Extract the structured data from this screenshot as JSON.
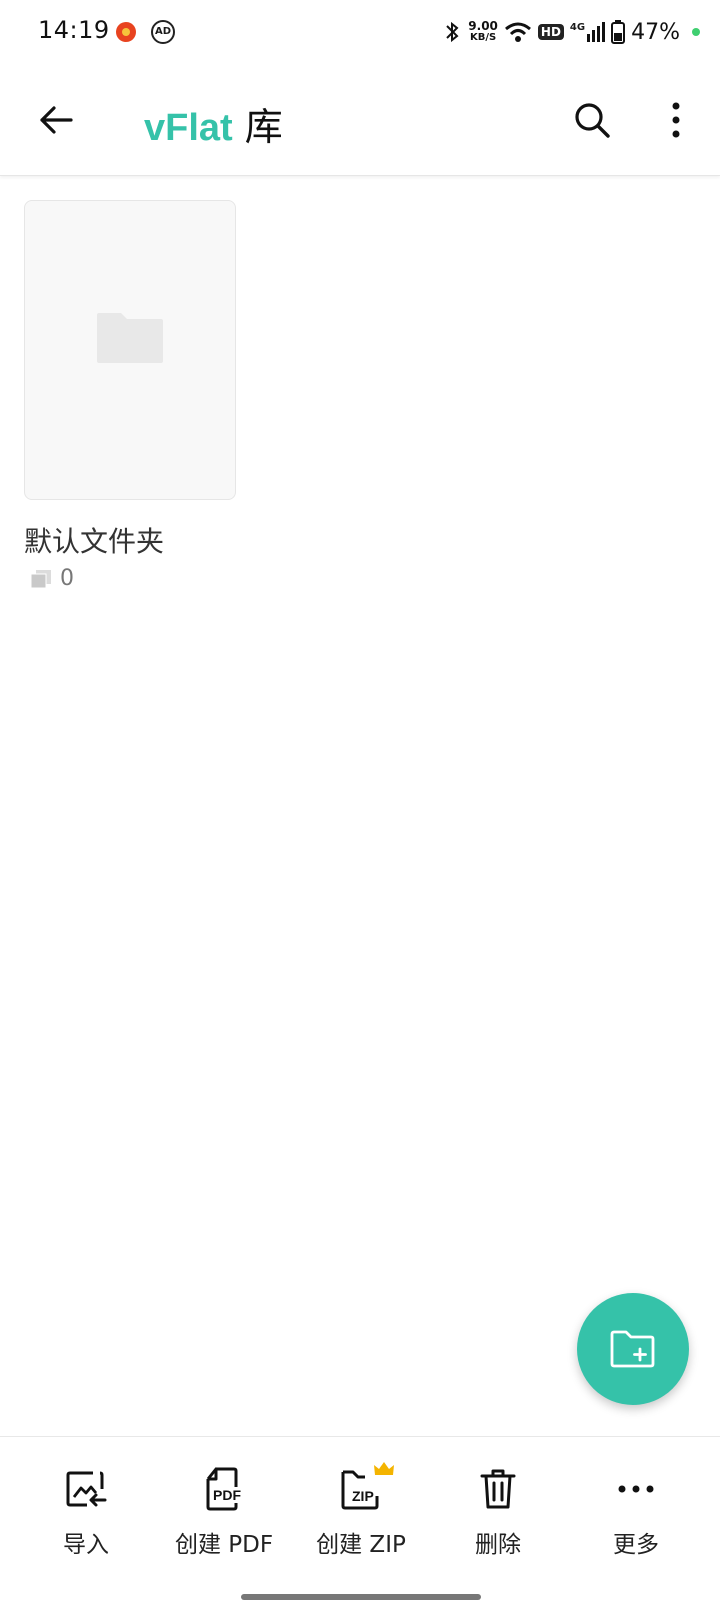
{
  "status_bar": {
    "time": "14:19",
    "net_speed_value": "9.00",
    "net_speed_unit": "KB/S",
    "hd": "HD",
    "cell": "4G",
    "battery": "47%"
  },
  "app_bar": {
    "brand": "vFlat",
    "title_suffix": "库"
  },
  "folders": [
    {
      "name": "默认文件夹",
      "count": "0"
    }
  ],
  "bottom_bar": {
    "import": "导入",
    "create_pdf": "创建 PDF",
    "create_zip": "创建 ZIP",
    "delete": "删除",
    "more": "更多"
  },
  "icons": {
    "pdf_text": "PDF",
    "zip_text": "ZIP"
  },
  "colors": {
    "accent": "#35c2a9",
    "premium": "#f4b400"
  }
}
